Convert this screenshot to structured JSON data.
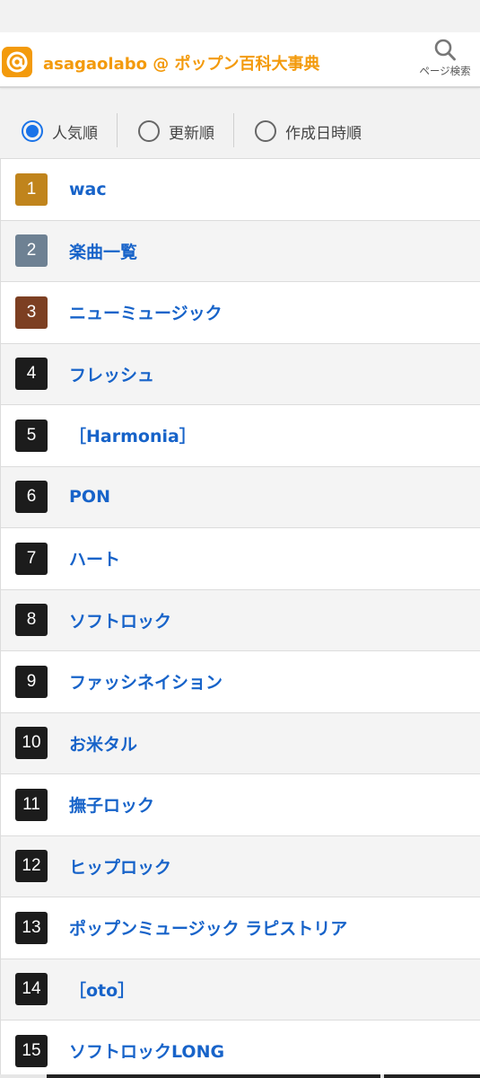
{
  "header": {
    "site_title": "asagaolabo @ ポップン百科大事典",
    "search_label": "ページ検索",
    "logo_icon": "at-sign-logo",
    "brand_color": "#f39a0c"
  },
  "sort": {
    "options": [
      {
        "label": "人気順",
        "selected": true
      },
      {
        "label": "更新順",
        "selected": false
      },
      {
        "label": "作成日時順",
        "selected": false
      }
    ]
  },
  "ranking": {
    "items": [
      {
        "rank": "1",
        "title": "wac",
        "badge_color": "#c0841c"
      },
      {
        "rank": "2",
        "title": "楽曲一覧",
        "badge_color": "#6e8193"
      },
      {
        "rank": "3",
        "title": "ニューミュージック",
        "badge_color": "#7c3f22"
      },
      {
        "rank": "4",
        "title": "フレッシュ",
        "badge_color": "#1c1c1c"
      },
      {
        "rank": "5",
        "title": "［Harmonia］",
        "badge_color": "#1c1c1c"
      },
      {
        "rank": "6",
        "title": "PON",
        "badge_color": "#1c1c1c"
      },
      {
        "rank": "7",
        "title": "ハート",
        "badge_color": "#1c1c1c"
      },
      {
        "rank": "8",
        "title": "ソフトロック",
        "badge_color": "#1c1c1c"
      },
      {
        "rank": "9",
        "title": "ファッシネイション",
        "badge_color": "#1c1c1c"
      },
      {
        "rank": "10",
        "title": "お米タル",
        "badge_color": "#1c1c1c"
      },
      {
        "rank": "11",
        "title": "撫子ロック",
        "badge_color": "#1c1c1c"
      },
      {
        "rank": "12",
        "title": "ヒップロック",
        "badge_color": "#1c1c1c"
      },
      {
        "rank": "13",
        "title": "ポップンミュージック ラピストリア",
        "badge_color": "#1c1c1c"
      },
      {
        "rank": "14",
        "title": "［oto］",
        "badge_color": "#1c1c1c"
      },
      {
        "rank": "15",
        "title": "ソフトロックLONG",
        "badge_color": "#1c1c1c"
      }
    ]
  }
}
